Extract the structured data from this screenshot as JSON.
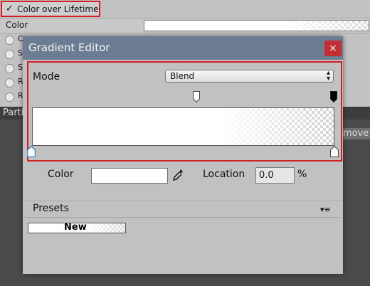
{
  "inspector": {
    "module_label": "Color over Lifetime",
    "color_label": "Color",
    "partial_bar": "Parti",
    "move_fragment": "move",
    "left_row_letters": [
      "C",
      "S",
      "S",
      "R",
      "R"
    ]
  },
  "dialog": {
    "title": "Gradient Editor",
    "close_glyph": "×",
    "mode_label": "Mode",
    "mode_value": "Blend",
    "color_label": "Color",
    "location_label": "Location",
    "location_value": "0.0",
    "percent_sign": "%",
    "presets_label": "Presets",
    "preset_new": "New"
  },
  "colors": {
    "title_bar": "#6c7d93",
    "close_button": "#c22e34",
    "highlight": "#d21f25",
    "selected_key": "#3a87d6"
  }
}
